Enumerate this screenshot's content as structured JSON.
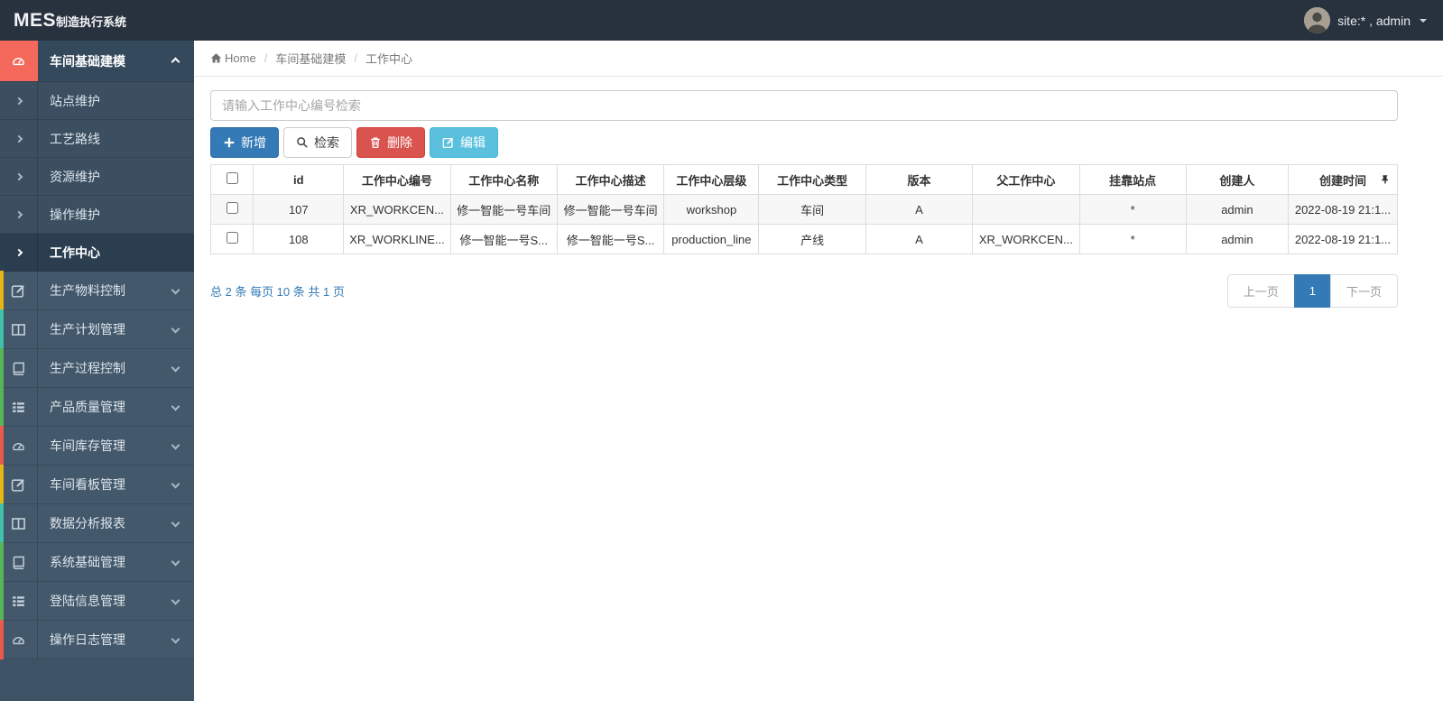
{
  "navbar": {
    "brand_bold": "MES",
    "brand_rest": "制造执行系统",
    "user": "site:* , admin"
  },
  "sidebar": {
    "items": [
      {
        "label": "车间基础建模",
        "icon": "gauge",
        "active": true,
        "expanded": true
      },
      {
        "label": "生产物料控制",
        "icon": "pencil-square"
      },
      {
        "label": "生产计划管理",
        "icon": "columns"
      },
      {
        "label": "生产过程控制",
        "icon": "book"
      },
      {
        "label": "产品质量管理",
        "icon": "th-list"
      },
      {
        "label": "车间库存管理",
        "icon": "gauge"
      },
      {
        "label": "车间看板管理",
        "icon": "pencil-square"
      },
      {
        "label": "数据分析报表",
        "icon": "columns"
      },
      {
        "label": "系统基础管理",
        "icon": "book"
      },
      {
        "label": "登陆信息管理",
        "icon": "th-list"
      },
      {
        "label": "操作日志管理",
        "icon": "gauge"
      }
    ],
    "submenu": [
      {
        "label": "站点维护"
      },
      {
        "label": "工艺路线"
      },
      {
        "label": "资源维护"
      },
      {
        "label": "操作维护"
      },
      {
        "label": "工作中心",
        "active": true
      }
    ]
  },
  "breadcrumb": {
    "home": "Home",
    "separator": "/",
    "level1": "车间基础建模",
    "level2": "工作中心"
  },
  "search": {
    "placeholder": "请输入工作中心编号检索"
  },
  "toolbar": {
    "add": "新增",
    "search": "检索",
    "delete": "删除",
    "edit": "编辑"
  },
  "table": {
    "columns": [
      "id",
      "工作中心编号",
      "工作中心名称",
      "工作中心描述",
      "工作中心层级",
      "工作中心类型",
      "版本",
      "父工作中心",
      "挂靠站点",
      "创建人",
      "创建时间"
    ],
    "rows": [
      [
        "107",
        "XR_WORKCEN...",
        "修一智能一号车间",
        "修一智能一号车间",
        "workshop",
        "车间",
        "A",
        "",
        "*",
        "admin",
        "2022-08-19 21:1..."
      ],
      [
        "108",
        "XR_WORKLINE...",
        "修一智能一号S...",
        "修一智能一号S...",
        "production_line",
        "产线",
        "A",
        "XR_WORKCEN...",
        "*",
        "admin",
        "2022-08-19 21:1..."
      ]
    ]
  },
  "pagination": {
    "summary": "总 2 条 每页 10 条 共 1 页",
    "prev": "上一页",
    "current": "1",
    "next": "下一页"
  },
  "colors": {
    "navbar_bg": "#28323e",
    "sidebar_bg": "#3e5366",
    "accent_red": "#f4695c",
    "primary_blue": "#337ab7",
    "danger_red": "#d9534f",
    "info_blue": "#5bc0de",
    "strip_yellow": "#e6b516",
    "strip_teal": "#3fc2a7",
    "strip_green": "#54b657",
    "strip_red": "#ea5a4c"
  }
}
